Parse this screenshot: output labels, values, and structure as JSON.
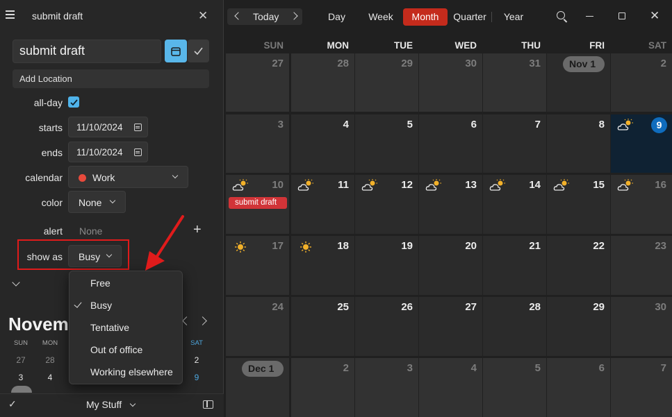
{
  "panel": {
    "header_title": "submit draft",
    "close_glyph": "✕",
    "title_value": "submit draft",
    "location_placeholder": "Add Location",
    "allday_label": "all-day",
    "allday_checked": true,
    "starts_label": "starts",
    "starts_value": "11/10/2024",
    "ends_label": "ends",
    "ends_value": "11/10/2024",
    "calendar_label": "calendar",
    "calendar_value": "Work",
    "calendar_color": "#e84a3c",
    "color_label": "color",
    "color_value": "None",
    "alert_label": "alert",
    "alert_value": "None",
    "showas_label": "show as",
    "showas_value": "Busy",
    "showas_options": [
      "Free",
      "Busy",
      "Tentative",
      "Out of office",
      "Working elsewhere"
    ],
    "showas_selected": "Busy"
  },
  "mini_cal": {
    "title": "Novem",
    "dow": [
      "SUN",
      "MON",
      "SAT"
    ],
    "row1": [
      "27",
      "28",
      "2"
    ],
    "row2": [
      "3",
      "4",
      "9"
    ]
  },
  "footer": {
    "check_glyph": "✓",
    "label": "My Stuff"
  },
  "toolbar": {
    "today": "Today",
    "views": [
      "Day",
      "Week",
      "Month",
      "Quarter",
      "Year"
    ],
    "active_view": "Month",
    "accent": "#c42b1c"
  },
  "calendar": {
    "dow": [
      "SUN",
      "MON",
      "TUE",
      "WED",
      "THU",
      "FRI",
      "SAT"
    ],
    "weeks": [
      [
        "27",
        "28",
        "29",
        "30",
        "31",
        "Nov 1",
        "2"
      ],
      [
        "3",
        "4",
        "5",
        "6",
        "7",
        "8",
        "9"
      ],
      [
        "10",
        "11",
        "12",
        "13",
        "14",
        "15",
        "16"
      ],
      [
        "17",
        "18",
        "19",
        "20",
        "21",
        "22",
        "23"
      ],
      [
        "24",
        "25",
        "26",
        "27",
        "28",
        "29",
        "30"
      ],
      [
        "Dec 1",
        "2",
        "3",
        "4",
        "5",
        "6",
        "7"
      ]
    ],
    "event_title": "submit draft",
    "event_color": "#d13438",
    "today_color": "#0f6cbd",
    "weather_partly_cloudy": "partly-cloudy-icon",
    "weather_sunny": "sun-icon"
  }
}
